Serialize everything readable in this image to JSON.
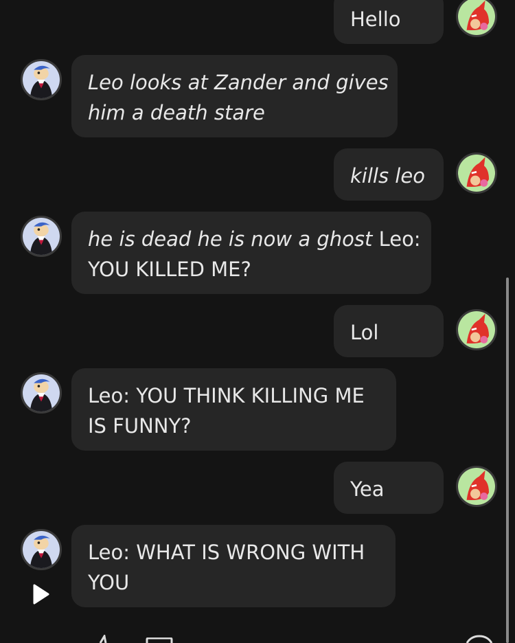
{
  "messages": [
    {
      "from": "user",
      "parts": [
        {
          "text": "Hello",
          "italic": false
        }
      ]
    },
    {
      "from": "bot",
      "lines": [
        [
          {
            "text": "Leo looks at Zander and gives",
            "italic": true
          }
        ],
        [
          {
            "text": "him a death stare",
            "italic": true
          }
        ]
      ]
    },
    {
      "from": "user",
      "parts": [
        {
          "text": "kills leo",
          "italic": true
        }
      ]
    },
    {
      "from": "bot",
      "lines": [
        [
          {
            "text": "he is dead he is now a ghost",
            "italic": true
          },
          {
            "text": " Leo:",
            "italic": false
          }
        ],
        [
          {
            "text": "YOU KILLED ME?",
            "italic": false
          }
        ]
      ]
    },
    {
      "from": "user",
      "parts": [
        {
          "text": "Lol",
          "italic": false
        }
      ]
    },
    {
      "from": "bot",
      "lines": [
        [
          {
            "text": "Leo: YOU THINK KILLING ME",
            "italic": false
          }
        ],
        [
          {
            "text": "IS FUNNY?",
            "italic": false
          }
        ]
      ]
    },
    {
      "from": "user",
      "parts": [
        {
          "text": "Yea",
          "italic": false
        }
      ]
    },
    {
      "from": "bot",
      "lines": [
        [
          {
            "text": "Leo: WHAT IS WRONG WITH",
            "italic": false
          }
        ],
        [
          {
            "text": "YOU",
            "italic": false
          }
        ]
      ]
    }
  ],
  "icons": {
    "bot_avatar": "leo-avatar-icon",
    "user_avatar": "fox-avatar-icon",
    "play": "play-icon"
  },
  "colors": {
    "background": "#141414",
    "bubble": "#262626",
    "text": "#e8e8e8"
  }
}
